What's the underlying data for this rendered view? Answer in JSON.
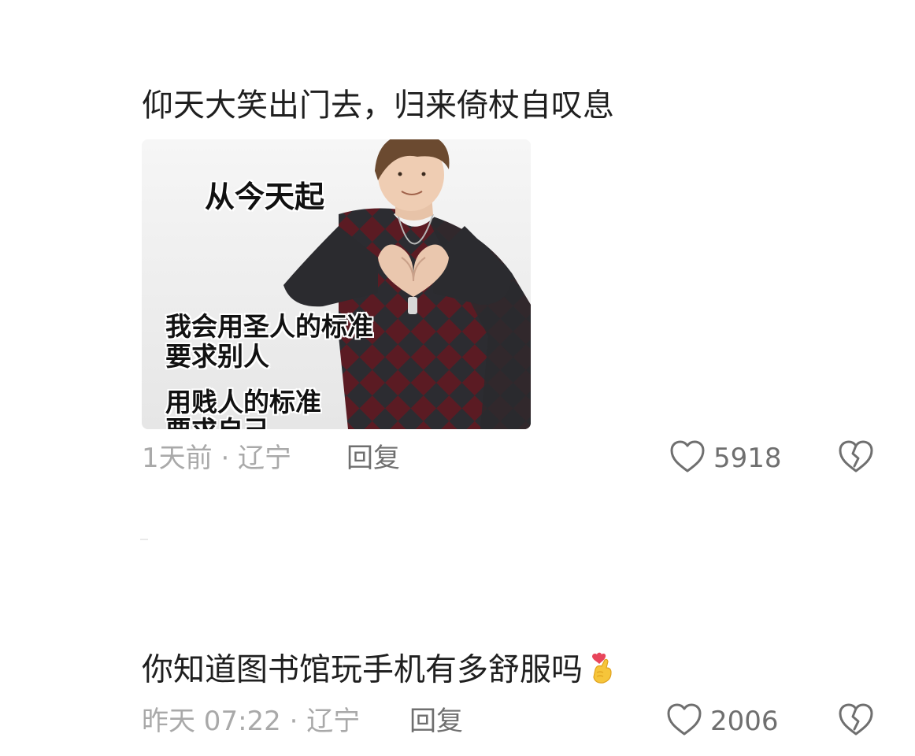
{
  "comments": [
    {
      "text": "仰天大笑出门去，归来倚杖自叹息",
      "image": {
        "caption_top": "从今天起",
        "caption_lines": [
          "我会用圣人的标准",
          "要求别人",
          "用贱人的标准",
          "要求自己"
        ]
      },
      "time_location": "1天前 · 辽宁",
      "reply_label": "回复",
      "likes": "5918"
    },
    {
      "text": "你知道图书馆玩手机有多舒服吗",
      "emoji": "finger-heart-emoji",
      "time_location": "昨天 07:22 · 辽宁",
      "reply_label": "回复",
      "likes": "2006"
    }
  ],
  "icons": {
    "like": "heart-outline-icon",
    "dislike": "broken-heart-icon"
  },
  "colors": {
    "text": "#1f1f1f",
    "meta": "#a9a9a9",
    "action": "#6f6f6f",
    "sweater_dark": "#2b2b2f",
    "sweater_red": "#6e1e26"
  }
}
